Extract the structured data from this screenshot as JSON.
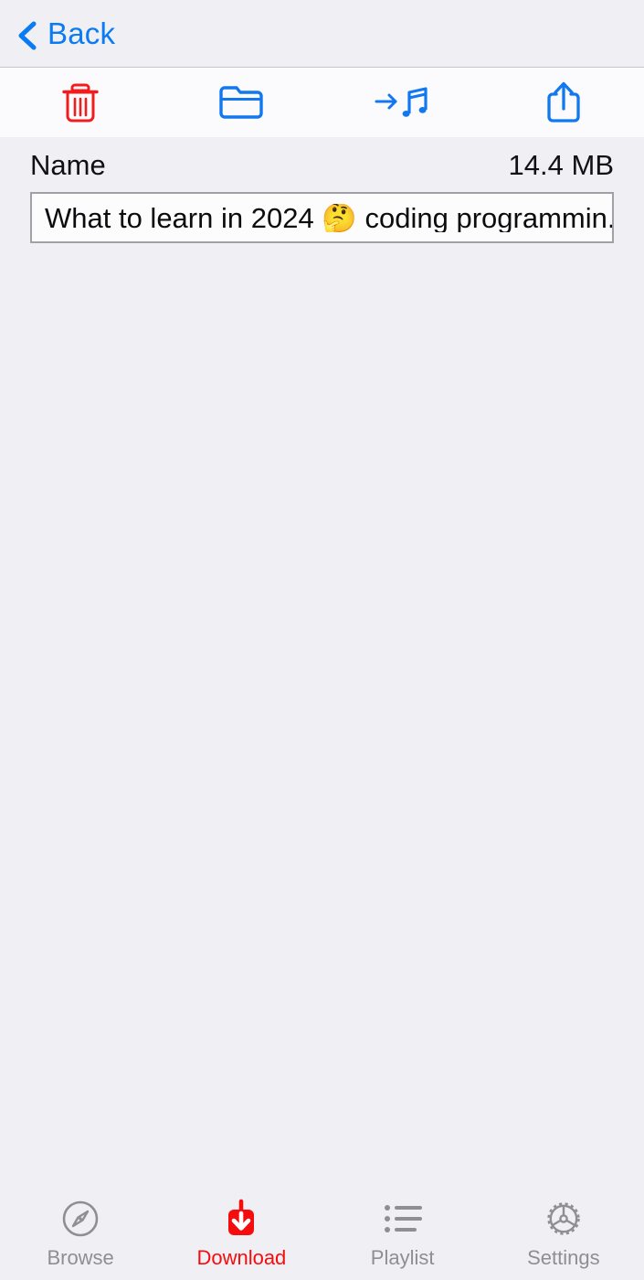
{
  "nav": {
    "back_label": "Back",
    "back_icon": "chevron-left-icon",
    "accent_color": "#0a7bf2"
  },
  "toolbar": {
    "items": [
      {
        "name": "delete-button",
        "icon": "trash-icon",
        "color": "#f11d1d"
      },
      {
        "name": "new-folder-button",
        "icon": "folder-icon",
        "color": "#1178ef"
      },
      {
        "name": "move-to-music-button",
        "icon": "arrow-music-note-icon",
        "color": "#1178ef"
      },
      {
        "name": "share-button",
        "icon": "share-upload-icon",
        "color": "#1178ef"
      }
    ]
  },
  "list_header": {
    "name_label": "Name",
    "size_label": "14.4 MB"
  },
  "files": [
    {
      "name": "What to learn in 2024 🤔 coding programmin...",
      "selected": true
    }
  ],
  "tab_bar": {
    "active_color": "#f50d0d",
    "inactive_color": "#8e8e93",
    "items": [
      {
        "name": "tab-browse",
        "label": "Browse",
        "icon": "compass-icon",
        "active": false
      },
      {
        "name": "tab-download",
        "label": "Download",
        "icon": "download-box-icon",
        "active": true
      },
      {
        "name": "tab-playlist",
        "label": "Playlist",
        "icon": "bulleted-list-icon",
        "active": false
      },
      {
        "name": "tab-settings",
        "label": "Settings",
        "icon": "gear-icon",
        "active": false
      }
    ]
  }
}
